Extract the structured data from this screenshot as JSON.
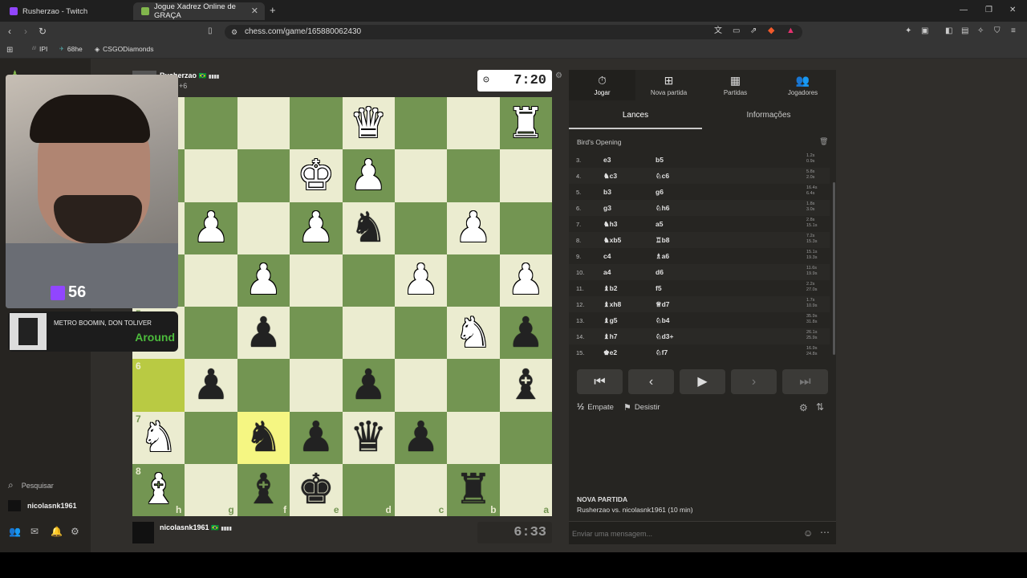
{
  "browser": {
    "tabs": [
      {
        "label": "Rusherzao - Twitch"
      },
      {
        "label": "Jogue Xadrez Online de GRAÇA"
      }
    ],
    "url": "chess.com/game/165880062430",
    "bookmarks": [
      "IPI",
      "68he",
      "CSGODiamonds"
    ]
  },
  "stream": {
    "viewer_count": "56",
    "music_artist": "METRO BOOMIN, DON TOLIVER",
    "music_title": "Around"
  },
  "sidebar": {
    "search_label": "Pesquisar",
    "username": "nicolasnk1961"
  },
  "top_player": {
    "name": "Rusherzao",
    "flag": "🇧🇷",
    "rating_bars": "▮▮▮▮",
    "material": "+6",
    "clock": "7:20"
  },
  "bottom_player": {
    "name": "nicolasnk1961",
    "flag": "🇧🇷",
    "rating_bars": "▮▮▮▮",
    "clock": "6:33"
  },
  "board": {
    "light_color": "#ebecd0",
    "dark_color": "#739552",
    "highlight_light": "#f5f682",
    "highlight_dark": "#b9ca43",
    "rows": [
      [
        "",
        "",
        "",
        "",
        "wQ",
        "",
        "",
        "wR"
      ],
      [
        "",
        "",
        "",
        "wK",
        "wP",
        "",
        "",
        ""
      ],
      [
        "",
        "wP",
        "",
        "wP",
        "bN",
        "",
        "wP",
        ""
      ],
      [
        "",
        "",
        "wP",
        "",
        "",
        "wP",
        "",
        "wP"
      ],
      [
        "",
        "",
        "bP",
        "",
        "",
        "",
        "wN",
        "bP"
      ],
      [
        "",
        "bP",
        "",
        "",
        "bP",
        "",
        "",
        "bB"
      ],
      [
        "wN",
        "",
        "bN",
        "bP",
        "bQ",
        "bP",
        "",
        ""
      ],
      [
        "wB",
        "",
        "bB",
        "bK",
        "",
        "",
        "bR",
        ""
      ]
    ],
    "highlights": [
      [
        5,
        0
      ],
      [
        6,
        2
      ]
    ],
    "ranks": [
      "1",
      "2",
      "3",
      "4",
      "5",
      "6",
      "7",
      "8"
    ],
    "files": [
      "h",
      "g",
      "f",
      "e",
      "d",
      "c",
      "b",
      "a"
    ]
  },
  "panel": {
    "tabs": [
      {
        "icon": "⏱",
        "label": "Jogar"
      },
      {
        "icon": "⊞",
        "label": "Nova partida"
      },
      {
        "icon": "▦",
        "label": "Partidas"
      },
      {
        "icon": "👥",
        "label": "Jogadores"
      }
    ],
    "subtabs": [
      "Lances",
      "Informações"
    ],
    "opening": "Bird's Opening",
    "moves": [
      {
        "n": "3.",
        "w": "e3",
        "b": "b5",
        "wt": "1.2s",
        "bt": "0.9s"
      },
      {
        "n": "4.",
        "w": "♞c3",
        "b": "♘c6",
        "wt": "5.8s",
        "bt": "2.0s"
      },
      {
        "n": "5.",
        "w": "b3",
        "b": "g6",
        "wt": "16.4s",
        "bt": "6.4s"
      },
      {
        "n": "6.",
        "w": "g3",
        "b": "♘h6",
        "wt": "1.8s",
        "bt": "3.0s"
      },
      {
        "n": "7.",
        "w": "♞h3",
        "b": "a5",
        "wt": "2.8s",
        "bt": "15.1s"
      },
      {
        "n": "8.",
        "w": "♞xb5",
        "b": "♖b8",
        "wt": "7.2s",
        "bt": "15.3s"
      },
      {
        "n": "9.",
        "w": "c4",
        "b": "♗a6",
        "wt": "15.1s",
        "bt": "19.3s"
      },
      {
        "n": "10.",
        "w": "a4",
        "b": "d6",
        "wt": "11.6s",
        "bt": "19.9s"
      },
      {
        "n": "11.",
        "w": "♝b2",
        "b": "f5",
        "wt": "2.2s",
        "bt": "27.0s"
      },
      {
        "n": "12.",
        "w": "♝xh8",
        "b": "♕d7",
        "wt": "1.7s",
        "bt": "10.9s"
      },
      {
        "n": "13.",
        "w": "♝g5",
        "b": "♘b4",
        "wt": "35.9s",
        "bt": "31.8s"
      },
      {
        "n": "14.",
        "w": "♝h7",
        "b": "♘d3+",
        "wt": "26.1s",
        "bt": "25.9s"
      },
      {
        "n": "15.",
        "w": "♚e2",
        "b": "♘f7",
        "wt": "16.9s",
        "bt": "24.8s"
      }
    ],
    "draw_label": "Empate",
    "resign_label": "Desistir",
    "new_game_title": "NOVA PARTIDA",
    "new_game_desc": "Rusherzao vs. nicolasnk1961 (10 min)",
    "chat_placeholder": "Enviar uma mensagem..."
  }
}
